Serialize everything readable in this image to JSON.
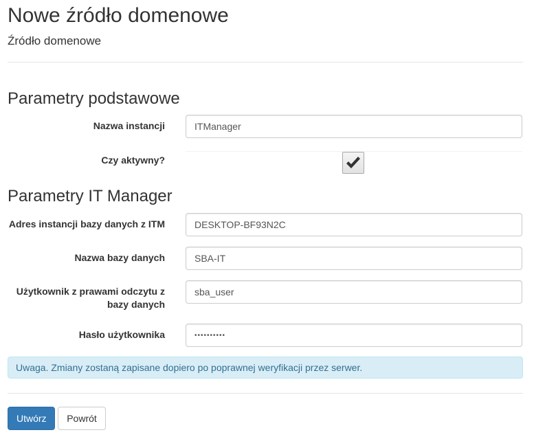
{
  "header": {
    "title": "Nowe źródło domenowe",
    "subtitle": "Źródło domenowe"
  },
  "sections": {
    "basic": {
      "title": "Parametry podstawowe",
      "instance_name": {
        "label": "Nazwa instancji",
        "value": "ITManager"
      },
      "active": {
        "label": "Czy aktywny?",
        "checked": true
      }
    },
    "itmanager": {
      "title": "Parametry IT Manager",
      "db_instance_address": {
        "label": "Adres instancji bazy danych z ITM",
        "value": "DESKTOP-BF93N2C"
      },
      "db_name": {
        "label": "Nazwa bazy danych",
        "value": "SBA-IT"
      },
      "db_user": {
        "label": "Użytkownik z prawami odczytu z bazy danych",
        "value": "sba_user"
      },
      "user_password": {
        "label": "Hasło użytkownika",
        "value": "••••••••••"
      }
    }
  },
  "alert": {
    "text": "Uwaga. Zmiany zostaną zapisane dopiero po poprawnej weryfikacji przez serwer."
  },
  "actions": {
    "create_label": "Utwórz",
    "back_label": "Powrót"
  },
  "colors": {
    "primary": "#337ab7",
    "alert_bg": "#d9edf7",
    "alert_text": "#31708f"
  }
}
